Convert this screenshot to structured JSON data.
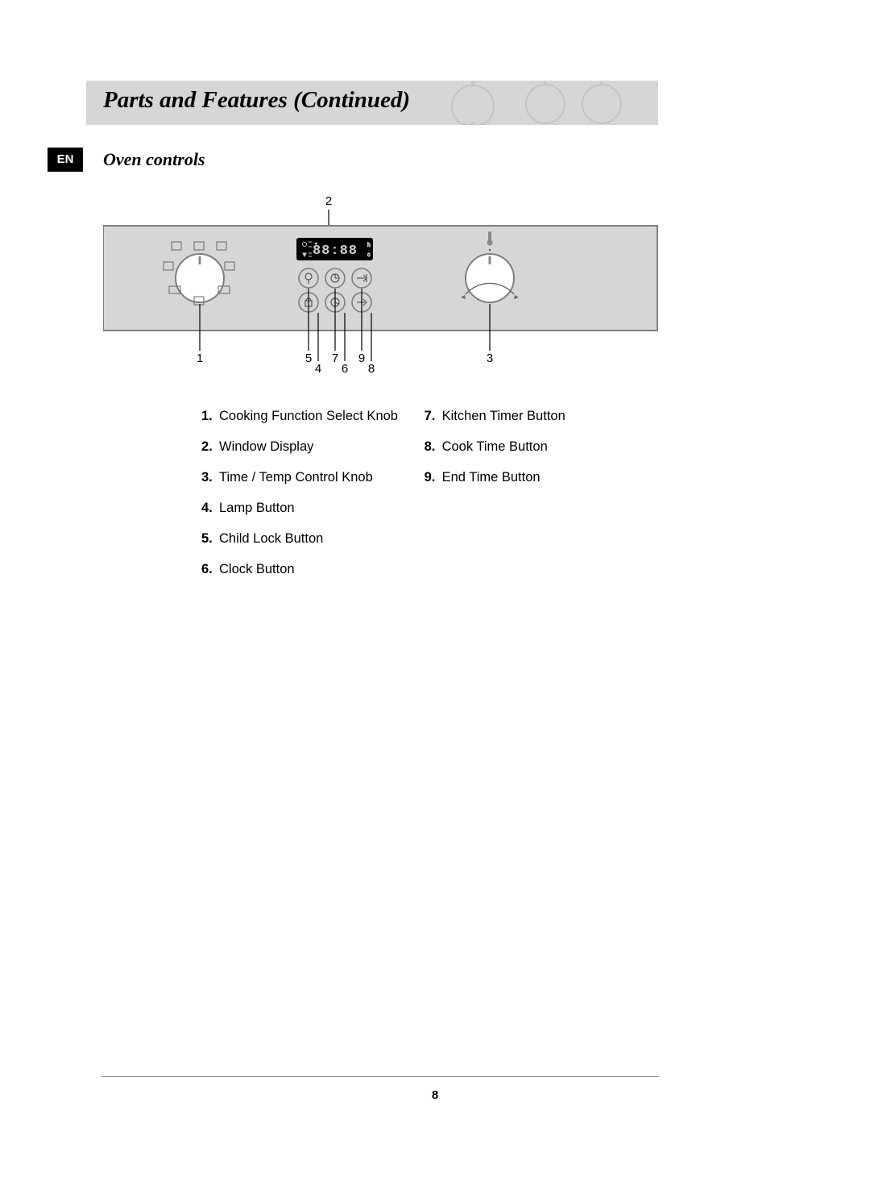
{
  "header": {
    "title": "Parts and Features (Continued)"
  },
  "lang_tag": "EN",
  "subtitle": "Oven controls",
  "diagram": {
    "display_text": "88:88",
    "callouts": {
      "n1": "1",
      "n2": "2",
      "n3": "3",
      "n4": "4",
      "n5": "5",
      "n6": "6",
      "n7": "7",
      "n8": "8",
      "n9": "9"
    }
  },
  "legend": {
    "left": [
      {
        "n": "1.",
        "t": "Cooking Function Select Knob"
      },
      {
        "n": "2.",
        "t": "Window Display"
      },
      {
        "n": "3.",
        "t": "Time / Temp Control Knob"
      },
      {
        "n": "4.",
        "t": "Lamp Button"
      },
      {
        "n": "5.",
        "t": "Child Lock Button"
      },
      {
        "n": "6.",
        "t": "Clock Button"
      }
    ],
    "right": [
      {
        "n": "7.",
        "t": "Kitchen Timer Button"
      },
      {
        "n": "8.",
        "t": "Cook Time Button"
      },
      {
        "n": "9.",
        "t": "End Time Button"
      }
    ]
  },
  "page_number": "8"
}
